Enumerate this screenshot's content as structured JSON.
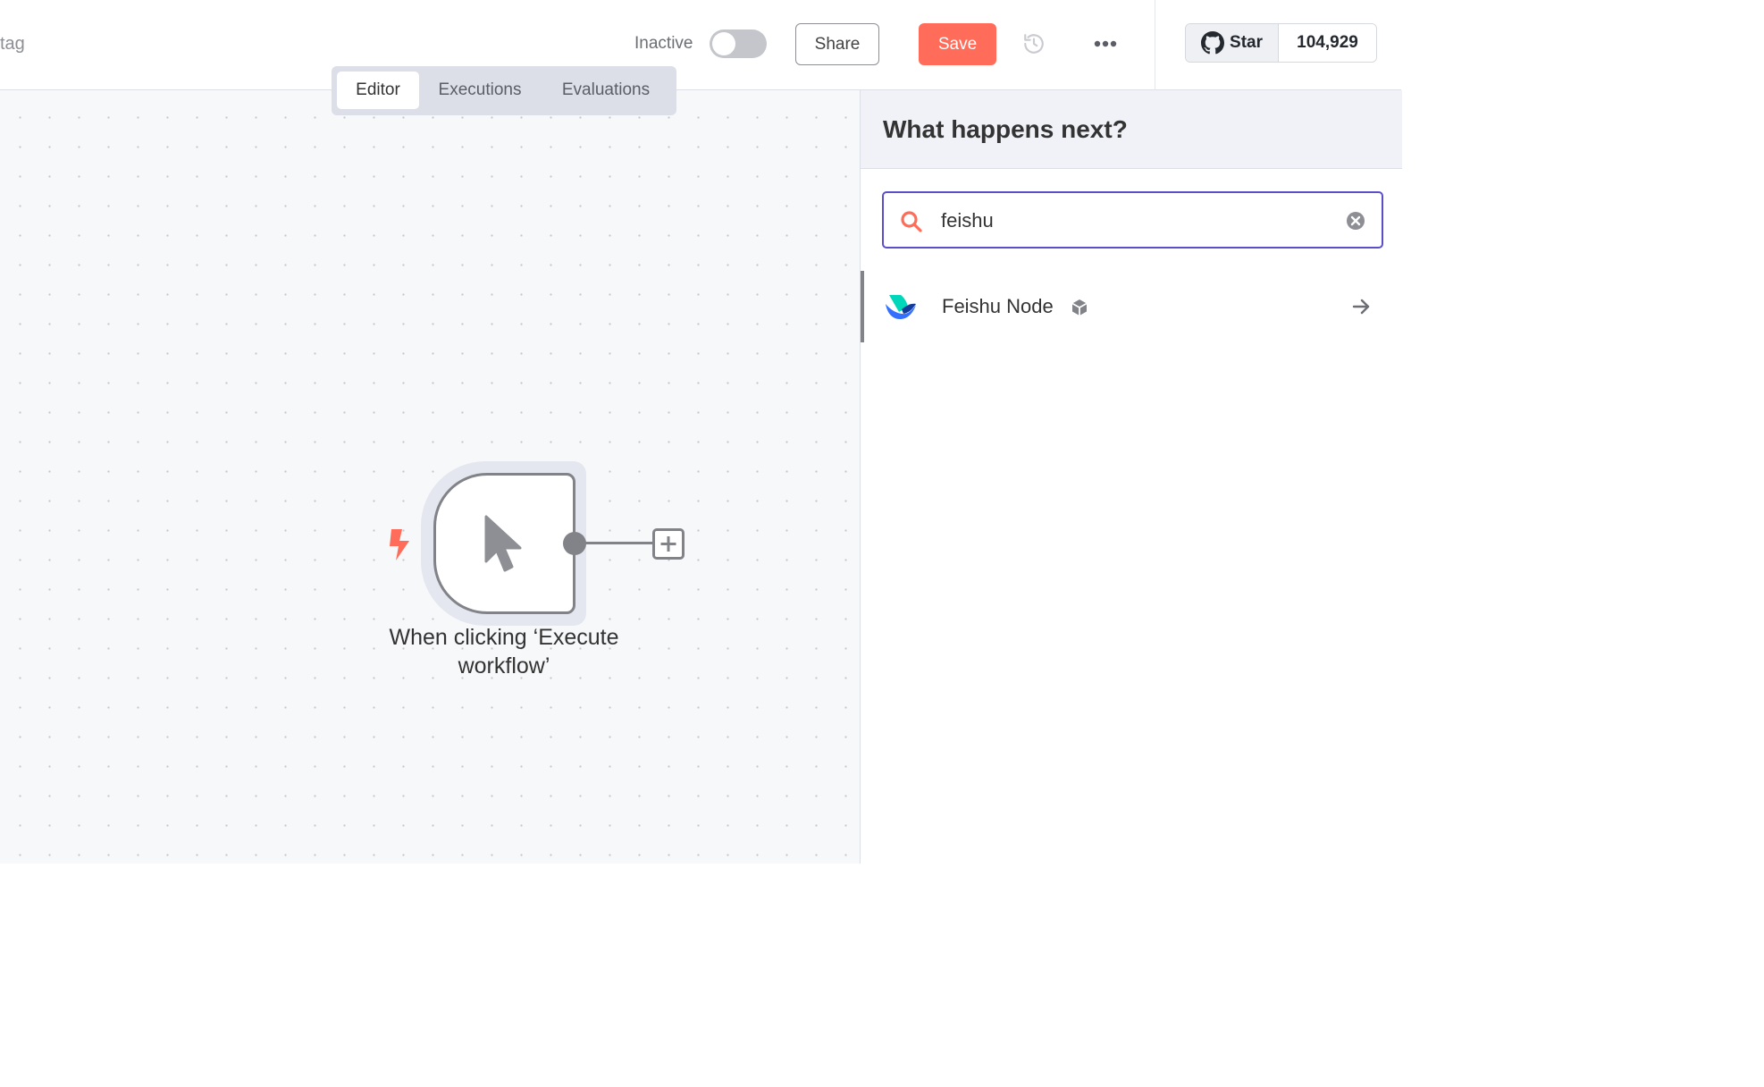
{
  "header": {
    "tag_text": "tag",
    "status_label": "Inactive",
    "share_label": "Share",
    "save_label": "Save",
    "github": {
      "star_label": "Star",
      "star_count": "104,929"
    }
  },
  "tabs": [
    {
      "label": "Editor",
      "active": true
    },
    {
      "label": "Executions",
      "active": false
    },
    {
      "label": "Evaluations",
      "active": false
    }
  ],
  "canvas": {
    "trigger_node": {
      "label_line1": "When clicking ‘Execute",
      "label_line2": "workflow’",
      "icon": "mouse-pointer-icon"
    }
  },
  "panel": {
    "title": "What happens next?",
    "search": {
      "value": "feishu",
      "placeholder": ""
    },
    "results": [
      {
        "label": "Feishu Node",
        "icon": "feishu-logo",
        "badge_icon": "cube-icon"
      }
    ]
  },
  "colors": {
    "accent": "#ff6d5a",
    "search_border": "#5b4fc8",
    "node_border": "#818389"
  }
}
